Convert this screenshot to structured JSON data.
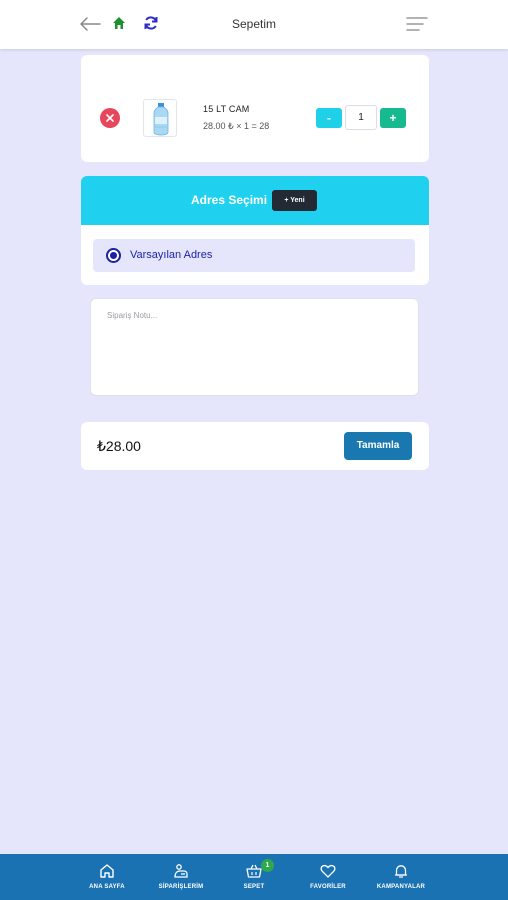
{
  "header": {
    "title": "Sepetim",
    "back_icon": "arrow-left-icon",
    "home_icon": "home-icon",
    "refresh_icon": "refresh-icon",
    "menu_icon": "menu-icon"
  },
  "cart": {
    "items": [
      {
        "name": "15 LT CAM",
        "price_line": "28.00 ₺ × 1 = 28",
        "quantity": "1",
        "minus_label": "-",
        "plus_label": "+"
      }
    ]
  },
  "address": {
    "title": "Adres Seçimi",
    "new_button": "+ Yeni",
    "options": [
      {
        "label": "Varsayılan Adres",
        "selected": true
      }
    ]
  },
  "note": {
    "placeholder": "Sipariş Notu..."
  },
  "summary": {
    "total": "₺28.00",
    "complete_button": "Tamamla"
  },
  "bottom_nav": {
    "items": [
      {
        "label": "ANA SAYFA",
        "icon": "home-icon"
      },
      {
        "label": "SİPARİŞLERİM",
        "icon": "orders-icon"
      },
      {
        "label": "SEPET",
        "icon": "basket-icon",
        "badge": "1"
      },
      {
        "label": "FAVORİLER",
        "icon": "heart-icon"
      },
      {
        "label": "KAMPANYALAR",
        "icon": "bell-icon"
      }
    ]
  },
  "colors": {
    "background": "#e5e6fb",
    "accent_cyan": "#1fd1ef",
    "primary_blue": "#1a72b3",
    "remove_red": "#e8465c",
    "plus_green": "#17b98f",
    "radio_blue": "#1d1fa8"
  }
}
